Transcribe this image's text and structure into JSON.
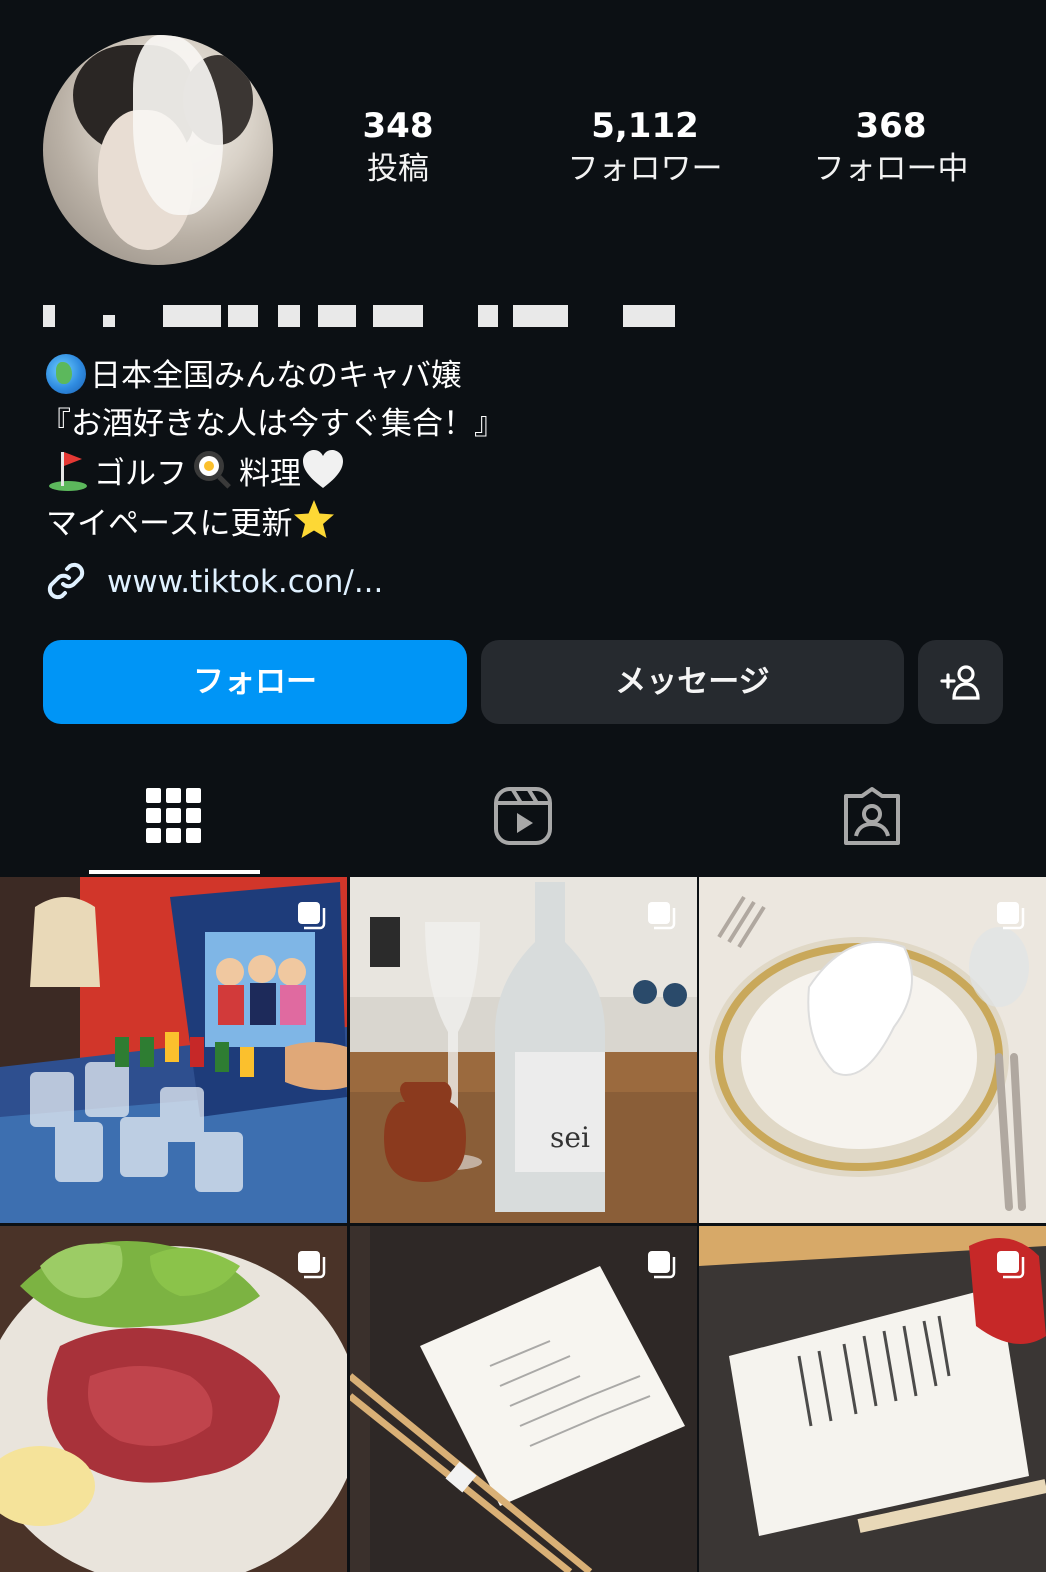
{
  "profile": {
    "stats": [
      {
        "value": "348",
        "label": "投稿"
      },
      {
        "value": "5,112",
        "label": "フォロワー"
      },
      {
        "value": "368",
        "label": "フォロー中"
      }
    ],
    "bio_lines": [
      "日本全国みんなのキャバ嬢",
      "『お酒好きな人は今すぐ集合！』",
      "ゴルフ",
      "料理",
      "マイペースに更新"
    ],
    "link": "www.tiktok.con/..."
  },
  "buttons": {
    "follow": "フォロー",
    "message": "メッセージ"
  },
  "icons": {
    "globe": "globe-emoji",
    "golf": "golf-flag-emoji",
    "pan": "frying-pan-emoji",
    "heart": "white-heart-emoji",
    "star": "star-emoji",
    "link": "link-icon",
    "add_person": "add-person-icon",
    "grid_tab": "grid-icon",
    "reels_tab": "reels-icon",
    "tagged_tab": "tagged-icon",
    "multi": "carousel-icon"
  },
  "colors": {
    "background": "#0c1014",
    "follow_button": "#0095f6",
    "secondary_button": "#262a2f",
    "link_text": "#e0f1ff"
  },
  "posts": [
    {
      "type": "carousel",
      "subject": "drinking board game with shot glasses"
    },
    {
      "type": "carousel",
      "subject": "sparkling wine bottle 'sei' and glass"
    },
    {
      "type": "carousel",
      "subject": "formal table setting with napkin"
    },
    {
      "type": "carousel",
      "subject": "horse meat sashimi with lettuce"
    },
    {
      "type": "carousel",
      "subject": "menu card with chopsticks"
    },
    {
      "type": "carousel",
      "subject": "handwritten Japanese menu"
    }
  ],
  "post_labels": {
    "bottle": "sei"
  }
}
